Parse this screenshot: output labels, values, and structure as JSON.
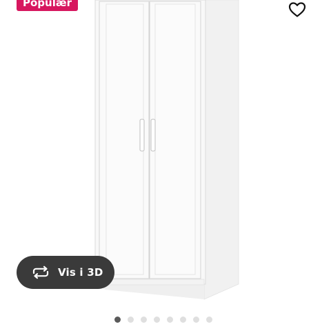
{
  "badge": {
    "label": "Populær",
    "color": "#d7175f"
  },
  "favorite": {
    "icon": "heart-outline-icon"
  },
  "product_image": {
    "alt": ""
  },
  "view3d": {
    "label": "Vis i 3D",
    "icon": "rotate-3d-icon"
  },
  "carousel": {
    "count": 8,
    "active_index": 0
  }
}
